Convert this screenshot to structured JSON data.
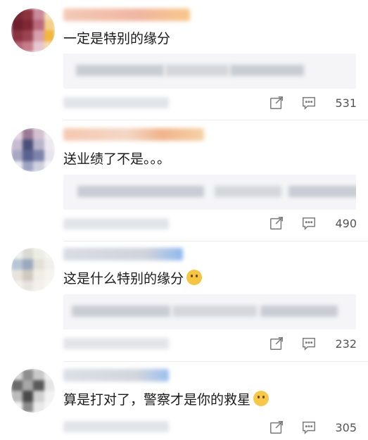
{
  "comments": [
    {
      "text": "一定是特别的缘分",
      "likes": "531",
      "emoji": ""
    },
    {
      "text": "送业绩了不是。。。",
      "likes": "490",
      "emoji": ""
    },
    {
      "text": "这是什么特别的缘分",
      "likes": "232",
      "emoji": "doge-emoji"
    },
    {
      "text": "算是打对了，警察才是你的救星",
      "likes": "305",
      "emoji": "666-emoji"
    }
  ],
  "icons": {
    "share": "share-icon",
    "comment": "comment-icon",
    "like": "thumbs-up-icon"
  },
  "colors": {
    "icon": "#7a7a7a",
    "reply_bg": "#f5f5f7",
    "text": "#1a1a1a"
  }
}
